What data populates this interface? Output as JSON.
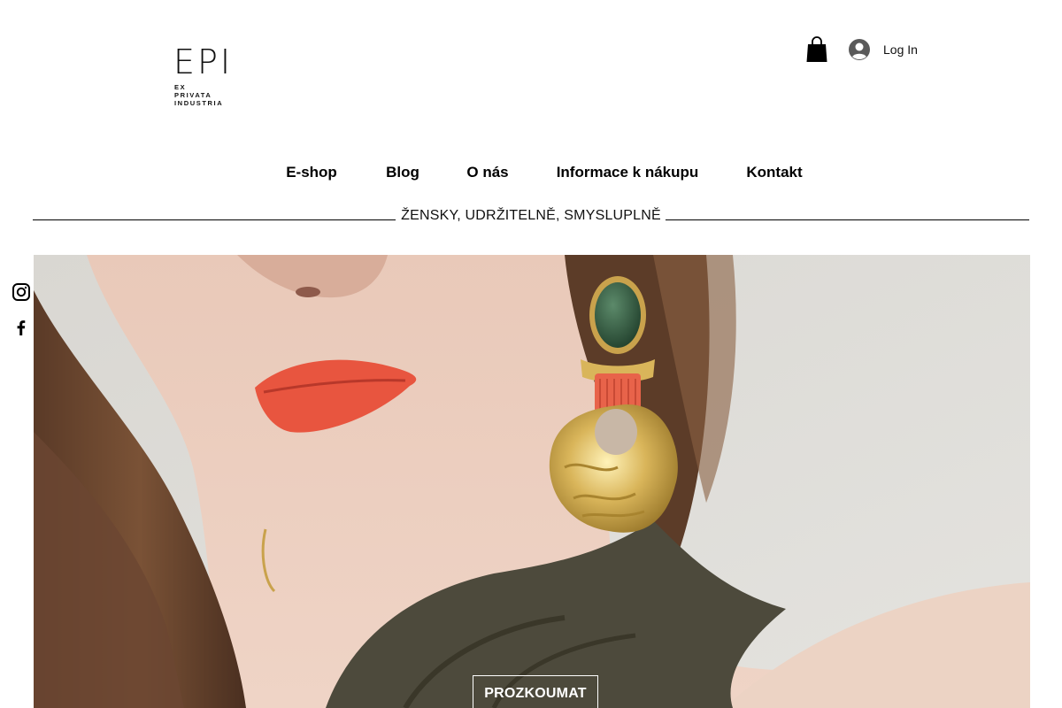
{
  "brand": {
    "logo_text": "EPI",
    "logo_sub": [
      "EX",
      "PRIVATA",
      "INDUSTRIA"
    ]
  },
  "header": {
    "cart_icon": "shopping-bag-icon",
    "login_label": "Log In",
    "avatar_icon": "user-avatar-icon"
  },
  "nav": {
    "items": [
      {
        "label": "E-shop"
      },
      {
        "label": "Blog"
      },
      {
        "label": "O nás"
      },
      {
        "label": "Informace k nákupu"
      },
      {
        "label": "Kontakt"
      }
    ]
  },
  "tagline": "ŽENSKY, UDRŽITELNĚ, SMYSLUPLNĚ",
  "social": {
    "items": [
      "instagram-icon",
      "facebook-icon"
    ]
  },
  "hero": {
    "cta_label": "PROZKOUMAT"
  },
  "colors": {
    "text": "#000000",
    "background": "#ffffff",
    "hero_wall": "#dcdcd8",
    "lips": "#e8553f",
    "earring_gold": "#d7b35a",
    "earring_green": "#2f5a40",
    "earring_beads": "#e8634a",
    "top_olive": "#4d4a3c"
  }
}
